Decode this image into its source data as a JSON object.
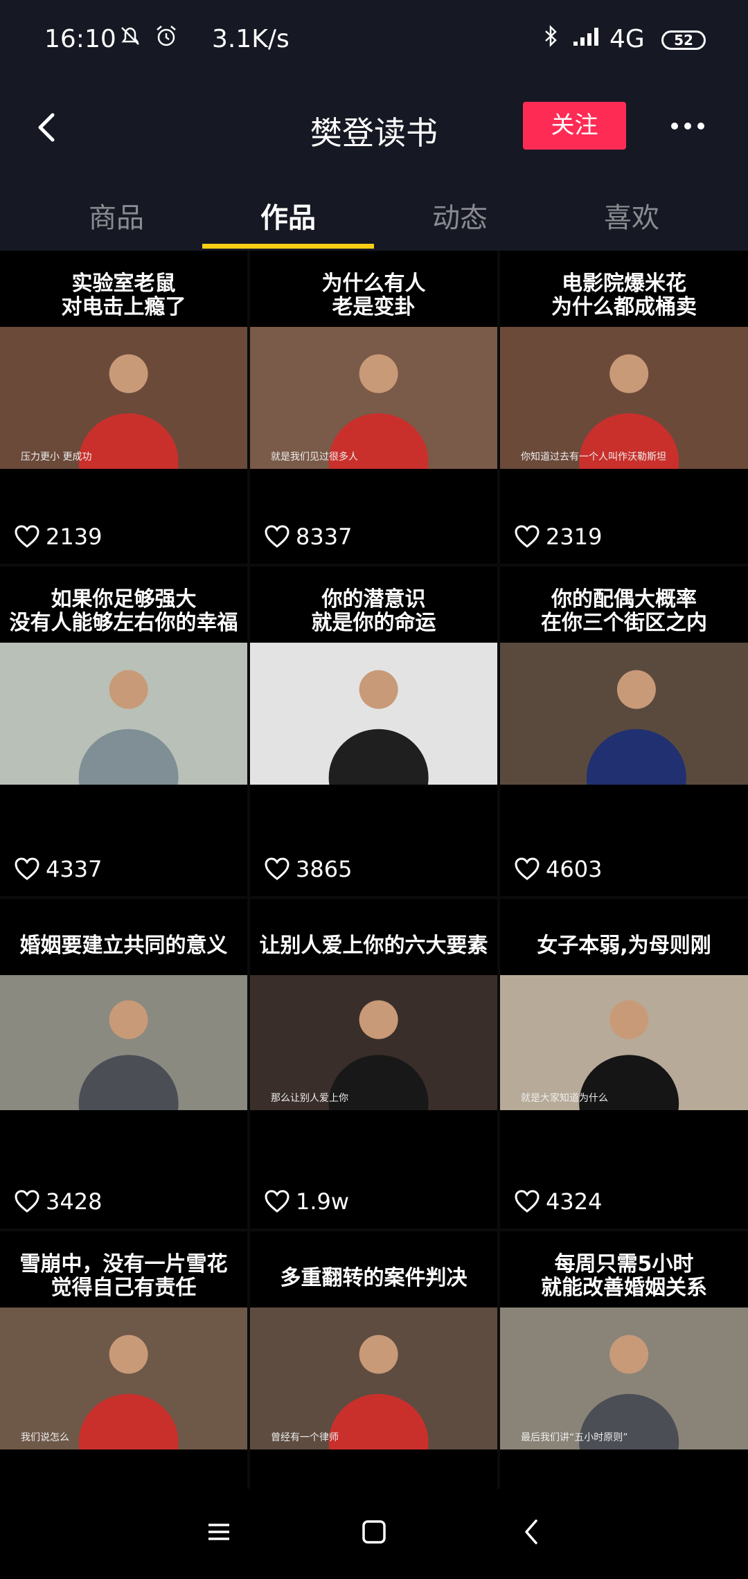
{
  "status": {
    "time": "16:10",
    "speed": "3.1K/s",
    "network": "4G",
    "battery": "52"
  },
  "header": {
    "title": "樊登读书",
    "follow_label": "关注"
  },
  "tabs": [
    {
      "label": "商品"
    },
    {
      "label": "作品"
    },
    {
      "label": "动态"
    },
    {
      "label": "喜欢"
    }
  ],
  "videos": [
    {
      "title_line1": "实验室老鼠",
      "title_line2": "对电击上瘾了",
      "caption": "压力更小 更成功",
      "likes": "2139"
    },
    {
      "title_line1": "为什么有人",
      "title_line2": "老是变卦",
      "caption": "就是我们见过很多人",
      "likes": "8337"
    },
    {
      "title_line1": "电影院爆米花",
      "title_line2": "为什么都成桶卖",
      "caption": "你知道过去有一个人叫作沃勒斯坦",
      "likes": "2319"
    },
    {
      "title_line1": "如果你足够强大",
      "title_line2": "没有人能够左右你的幸福",
      "caption": "",
      "likes": "4337"
    },
    {
      "title_line1": "你的潜意识",
      "title_line2": "就是你的命运",
      "caption": "",
      "likes": "3865"
    },
    {
      "title_line1": "你的配偶大概率",
      "title_line2": "在你三个街区之内",
      "caption": "",
      "likes": "4603"
    },
    {
      "title_line1": "婚姻要建立共同的意义",
      "title_line2": "",
      "caption": "",
      "likes": "3428"
    },
    {
      "title_line1": "让别人爱上你的六大要素",
      "title_line2": "",
      "caption": "那么让别人爱上你",
      "likes": "1.9w"
    },
    {
      "title_line1": "女子本弱,为母则刚",
      "title_line2": "",
      "caption": "就是大家知道为什么",
      "likes": "4324"
    },
    {
      "title_line1": "雪崩中，没有一片雪花",
      "title_line2": "觉得自己有责任",
      "caption": "我们说怎么",
      "likes": ""
    },
    {
      "title_line1": "多重翻转的案件判决",
      "title_line2": "",
      "caption": "曾经有一个律师",
      "likes": ""
    },
    {
      "title_line1": "每周只需5小时",
      "title_line2": "就能改善婚姻关系",
      "caption": "最后我们讲“五小时原则”",
      "likes": ""
    }
  ],
  "colors": {
    "background": "#161823",
    "follow": "#fe2c55",
    "tab_indicator": "#face15"
  }
}
